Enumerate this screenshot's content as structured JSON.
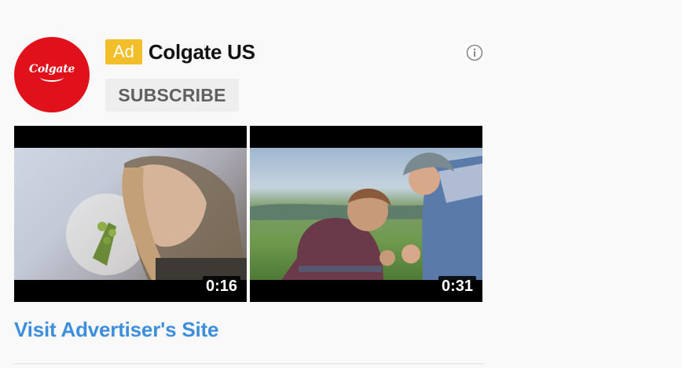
{
  "advertiser": {
    "logo_text": "Colgate",
    "ad_label": "Ad",
    "channel_name": "Colgate US",
    "subscribe_label": "SUBSCRIBE",
    "info_icon": "info-icon"
  },
  "videos": [
    {
      "duration": "0:16"
    },
    {
      "duration": "0:31"
    }
  ],
  "cta": {
    "visit_label": "Visit Advertiser's Site"
  },
  "colors": {
    "brand_red": "#e0111b",
    "ad_badge": "#f2bf2a",
    "link_blue": "#3d8fdd",
    "subscribe_bg": "#eeeeee"
  }
}
